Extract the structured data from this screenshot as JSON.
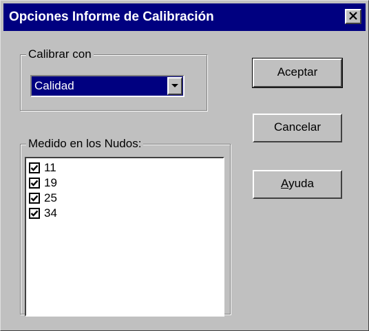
{
  "window": {
    "title": "Opciones Informe de Calibración",
    "close_label": "✕"
  },
  "calibrate_group": {
    "legend": "Calibrar con",
    "selected_value": "Calidad"
  },
  "nodes_group": {
    "legend": "Medido en los Nudos:",
    "items": [
      {
        "label": "11",
        "checked": true
      },
      {
        "label": "19",
        "checked": true
      },
      {
        "label": "25",
        "checked": true
      },
      {
        "label": "34",
        "checked": true
      }
    ]
  },
  "buttons": {
    "accept": "Aceptar",
    "cancel": "Cancelar",
    "help_first": "A",
    "help_rest": "yuda"
  },
  "colors": {
    "titlebar": "#000080",
    "face": "#c0c0c0"
  }
}
